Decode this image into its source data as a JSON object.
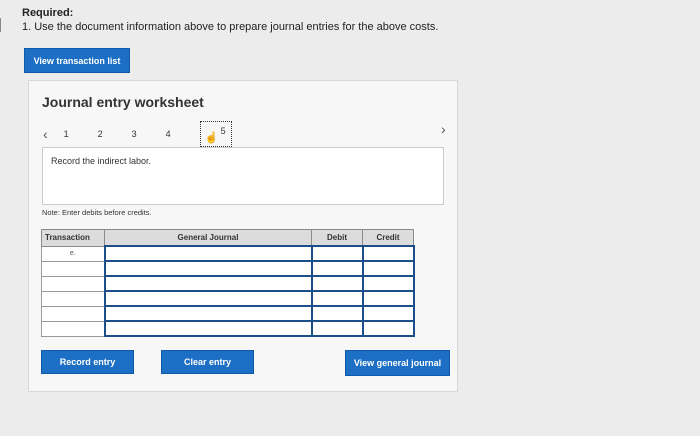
{
  "required": {
    "heading": "Required:",
    "item1": "1. Use the document information above to prepare journal entries for the above costs."
  },
  "buttons": {
    "view_transaction_list": "View transaction list",
    "record_entry": "Record entry",
    "clear_entry": "Clear entry",
    "view_general_journal": "View general journal"
  },
  "worksheet": {
    "title": "Journal entry worksheet",
    "pages": [
      "1",
      "2",
      "3",
      "4",
      "5"
    ],
    "active_page": "5",
    "instruction": "Record the indirect labor.",
    "note": "Note: Enter debits before credits."
  },
  "table": {
    "headers": [
      "Transaction",
      "General Journal",
      "Debit",
      "Credit"
    ],
    "rows": [
      {
        "transaction": "e."
      },
      {
        "transaction": ""
      },
      {
        "transaction": ""
      },
      {
        "transaction": ""
      },
      {
        "transaction": ""
      },
      {
        "transaction": ""
      }
    ]
  },
  "colors": {
    "accent": "#1c6fc4",
    "input_border": "#1c4f8a",
    "header_bg": "#dcdcdc"
  }
}
